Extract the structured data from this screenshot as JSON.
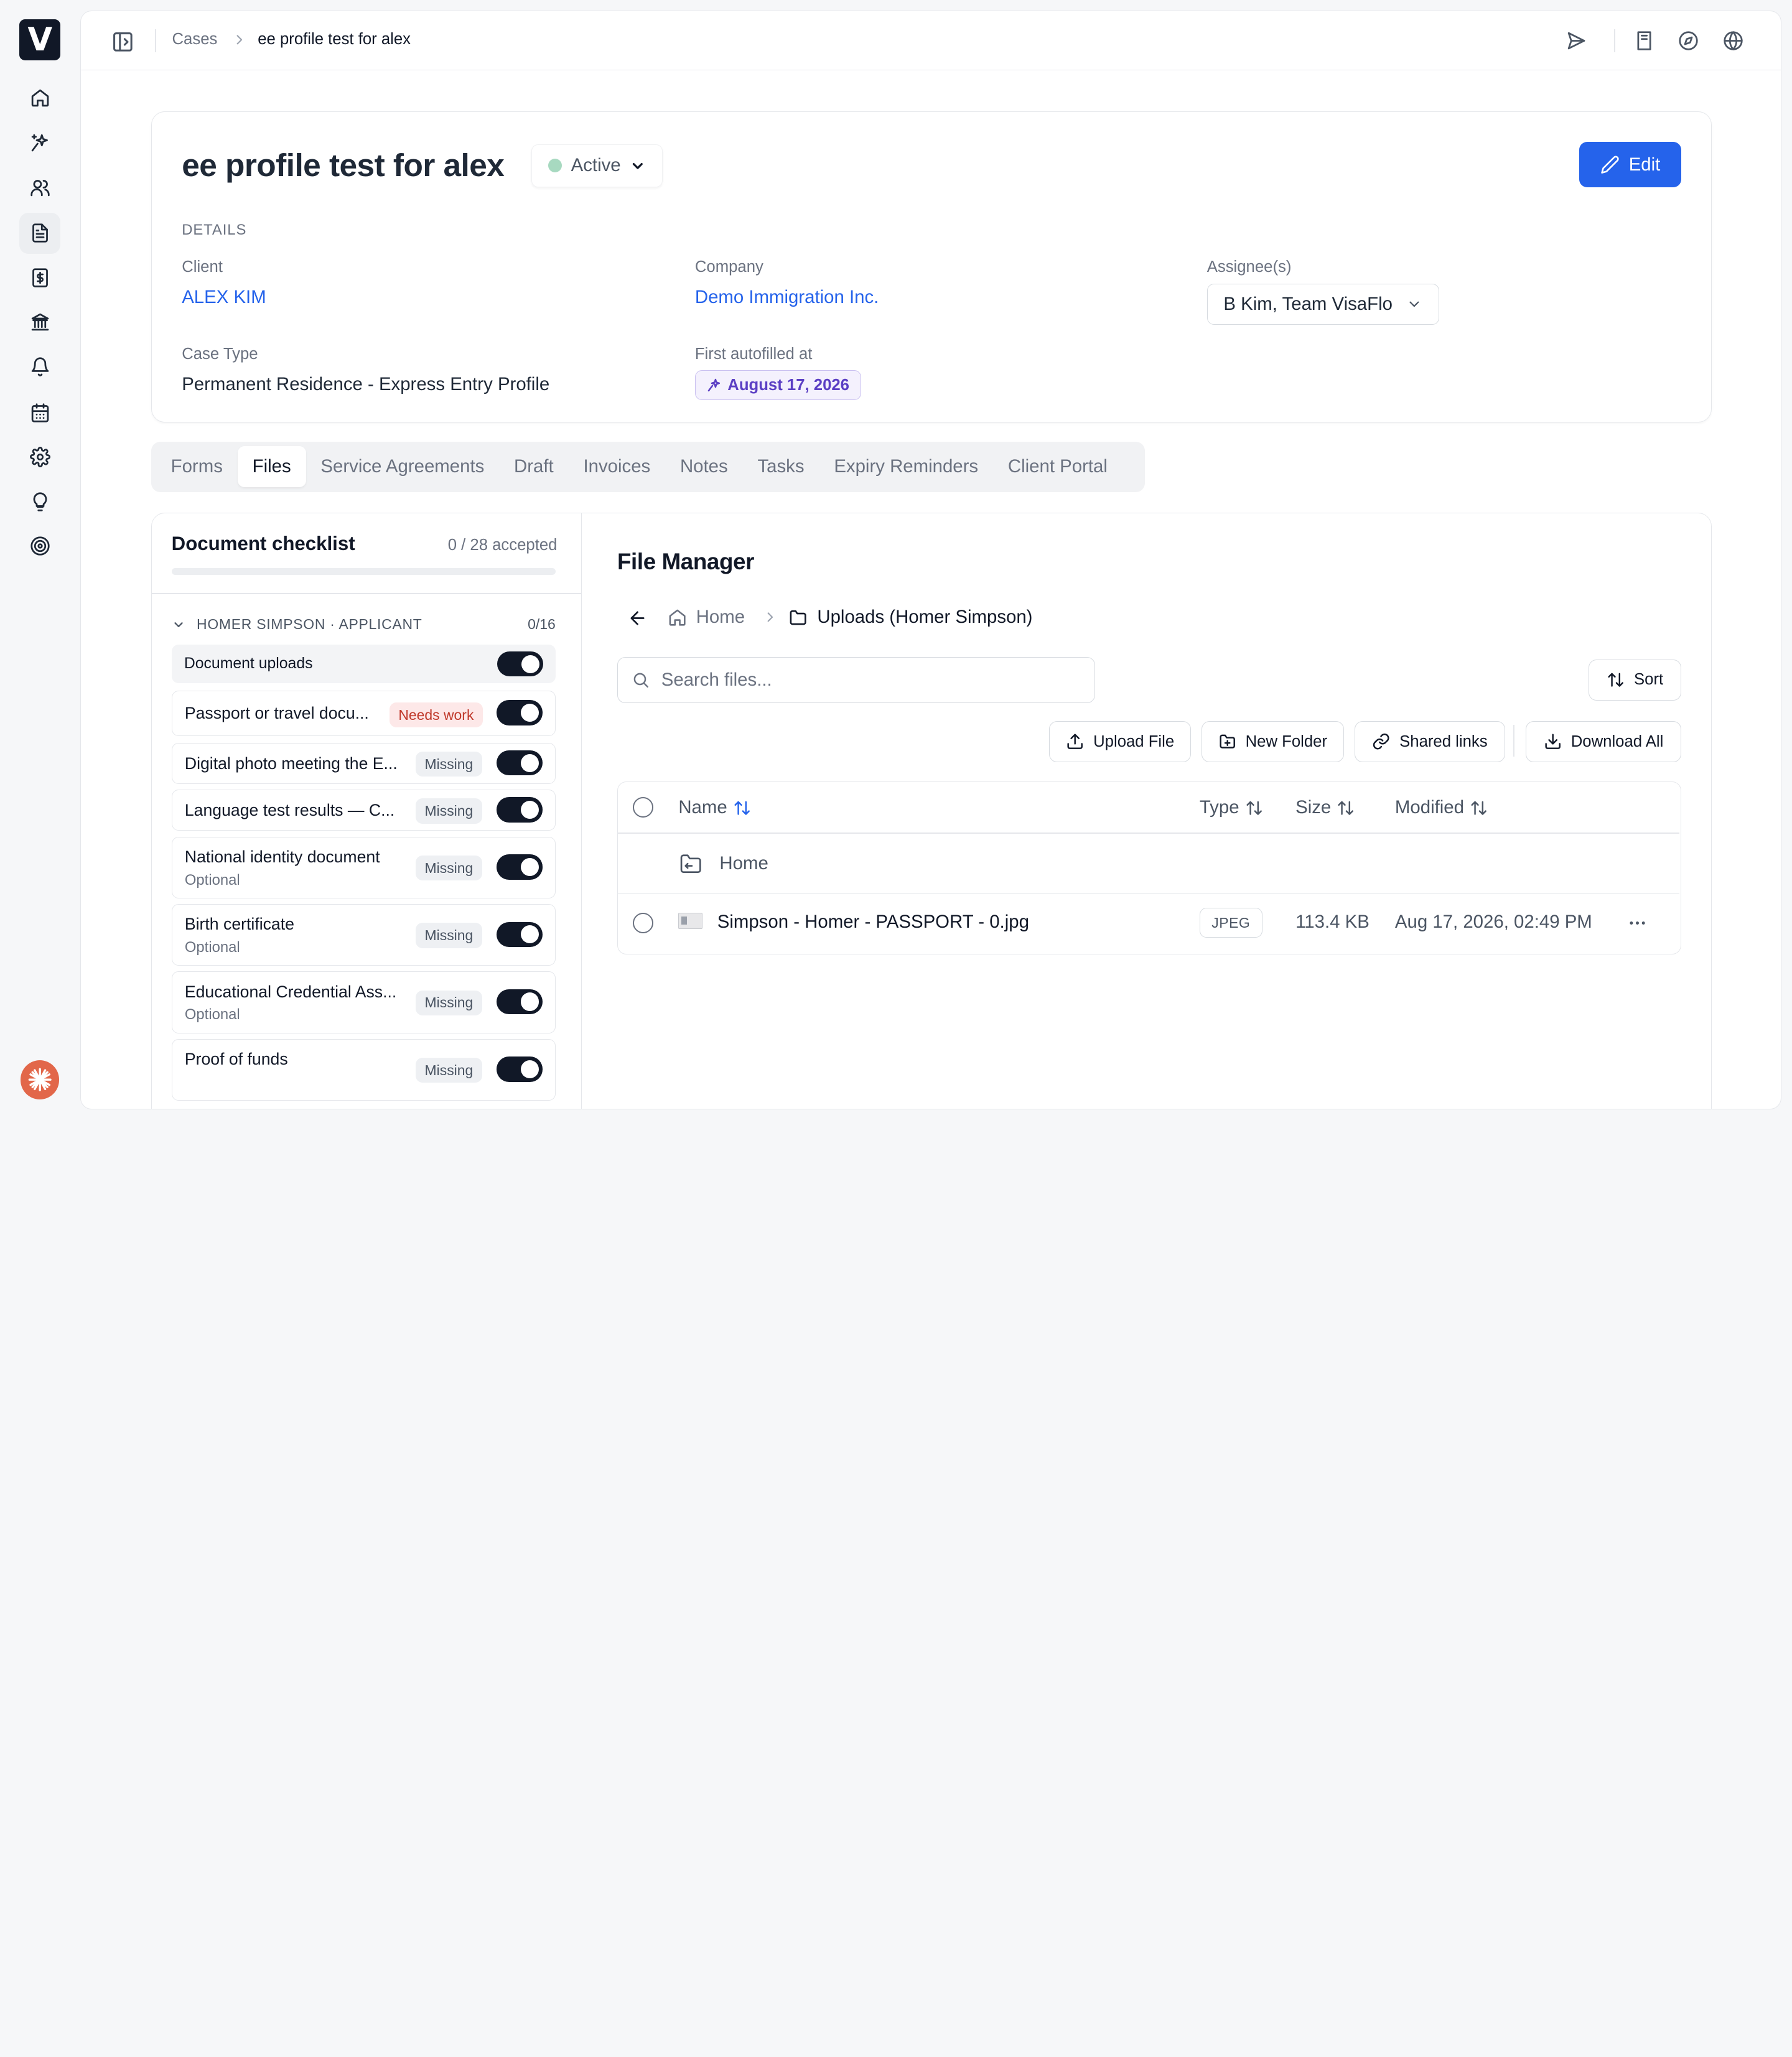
{
  "app": {
    "logo_letter": "V",
    "nav": [
      {
        "name": "home",
        "icon": "home-icon"
      },
      {
        "name": "ai",
        "icon": "sparkle-icon"
      },
      {
        "name": "clients",
        "icon": "users-icon"
      },
      {
        "name": "cases",
        "icon": "document-icon",
        "active": true
      },
      {
        "name": "invoices",
        "icon": "dollar-file-icon"
      },
      {
        "name": "government",
        "icon": "bank-icon"
      },
      {
        "name": "notifications",
        "icon": "bell-icon"
      },
      {
        "name": "calendar",
        "icon": "calendar-icon"
      },
      {
        "name": "settings",
        "icon": "gear-icon"
      },
      {
        "name": "tips",
        "icon": "lightbulb-icon"
      },
      {
        "name": "target",
        "icon": "target-icon"
      }
    ],
    "accent": "#2563eb"
  },
  "topbar": {
    "breadcrumb": {
      "root": "Cases",
      "current": "ee profile test for alex"
    },
    "icons": [
      "send-icon",
      "book-icon",
      "compass-icon",
      "globe-icon"
    ]
  },
  "case": {
    "title": "ee profile test for alex",
    "status": "Active",
    "edit_label": "Edit",
    "details_label": "DETAILS",
    "client_label": "Client",
    "client_value": "ALEX KIM",
    "company_label": "Company",
    "company_value": "Demo Immigration Inc.",
    "assignee_label": "Assignee(s)",
    "assignee_value": "B Kim, Team VisaFlo",
    "case_type_label": "Case Type",
    "case_type_value": "Permanent Residence - Express Entry Profile",
    "autofill_label": "First autofilled at",
    "autofill_value": "August 17, 2026"
  },
  "tabs": [
    "Forms",
    "Files",
    "Service Agreements",
    "Draft",
    "Invoices",
    "Notes",
    "Tasks",
    "Expiry Reminders",
    "Client Portal"
  ],
  "active_tab": "Files",
  "checklist": {
    "title": "Document checklist",
    "count": "0 / 28 accepted",
    "progress": 0,
    "group": {
      "label": "HOMER SIMPSON · APPLICANT",
      "count": "0/16"
    },
    "items": [
      {
        "name": "Document uploads",
        "enabled": true
      },
      {
        "name": "Passport or travel docu...",
        "status": "Needs work",
        "enabled": true
      },
      {
        "name": "Digital photo meeting the E...",
        "status": "Missing",
        "enabled": true
      },
      {
        "name": "Language test results — C...",
        "status": "Missing",
        "enabled": true
      },
      {
        "name": "National identity document",
        "sub": "Optional",
        "status": "Missing",
        "enabled": true
      },
      {
        "name": "Birth certificate",
        "sub": "Optional",
        "status": "Missing",
        "enabled": true
      },
      {
        "name": "Educational Credential Ass...",
        "sub": "Optional",
        "status": "Missing",
        "enabled": true
      },
      {
        "name": "Proof of funds",
        "status": "Missing",
        "enabled": true
      }
    ]
  },
  "file_manager": {
    "title": "File Manager",
    "breadcrumb": {
      "home": "Home",
      "folder": "Uploads (Homer Simpson)"
    },
    "search_placeholder": "Search files...",
    "sort_label": "Sort",
    "actions": {
      "upload": "Upload File",
      "new_folder": "New Folder",
      "shared_links": "Shared links",
      "download_all": "Download All"
    },
    "columns": {
      "name": "Name",
      "type": "Type",
      "size": "Size",
      "modified": "Modified"
    },
    "parent_folder": "Home",
    "files": [
      {
        "name": "Simpson - Homer - PASSPORT - 0.jpg",
        "type": "JPEG",
        "size": "113.4 KB",
        "modified": "Aug 17, 2026, 02:49 PM"
      }
    ]
  }
}
